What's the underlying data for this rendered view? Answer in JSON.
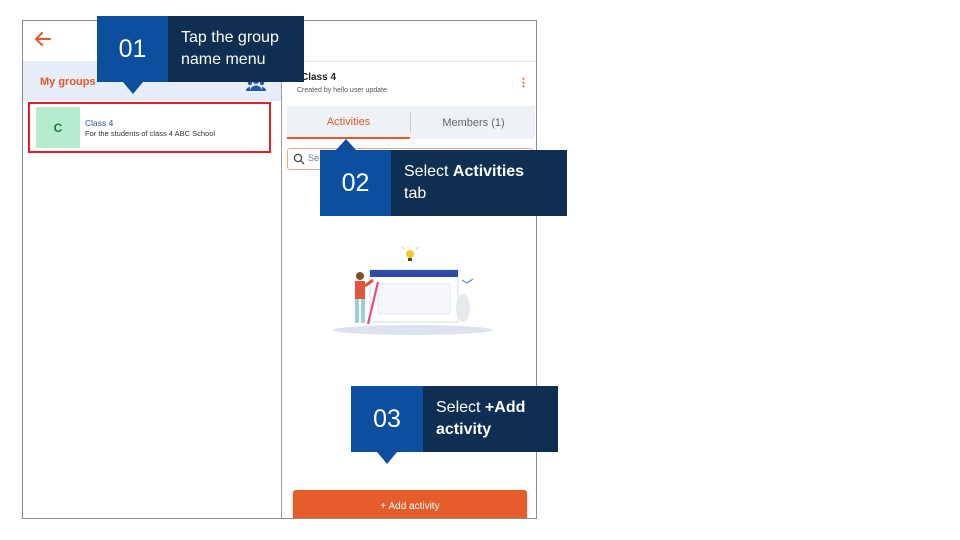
{
  "app": {
    "back_icon": "arrow-left-icon",
    "accent_color": "#e8562a"
  },
  "sidebar": {
    "title": "My groups",
    "group_icon": "group-people-icon",
    "groups": [
      {
        "avatar": "C",
        "name": "Class 4",
        "description": "For the students of class 4 ABC School",
        "highlighted": true
      }
    ]
  },
  "detail": {
    "title": "Class 4",
    "subtitle": "Created by hello user update",
    "menu_icon": "kebab-menu-icon",
    "tabs": [
      {
        "label": "Activities",
        "active": true
      },
      {
        "label": "Members (1)",
        "active": false
      }
    ],
    "search_placeholder": "Se",
    "add_button_label": "+ Add activity"
  },
  "callouts": [
    {
      "number": "01",
      "text_plain": "Tap the group name menu",
      "line1": "Tap the group",
      "line2": "name menu"
    },
    {
      "number": "02",
      "prefix": "Select ",
      "bold": "Activities",
      "suffix": "tab"
    },
    {
      "number": "03",
      "prefix": "Select ",
      "bold1": "+Add",
      "bold2": "activity"
    }
  ],
  "colors": {
    "callout_number_bg": "#0b4f9e",
    "callout_text_bg": "#0f2f52",
    "highlight_border": "#e01e2a",
    "button_bg": "#e65c2a"
  }
}
